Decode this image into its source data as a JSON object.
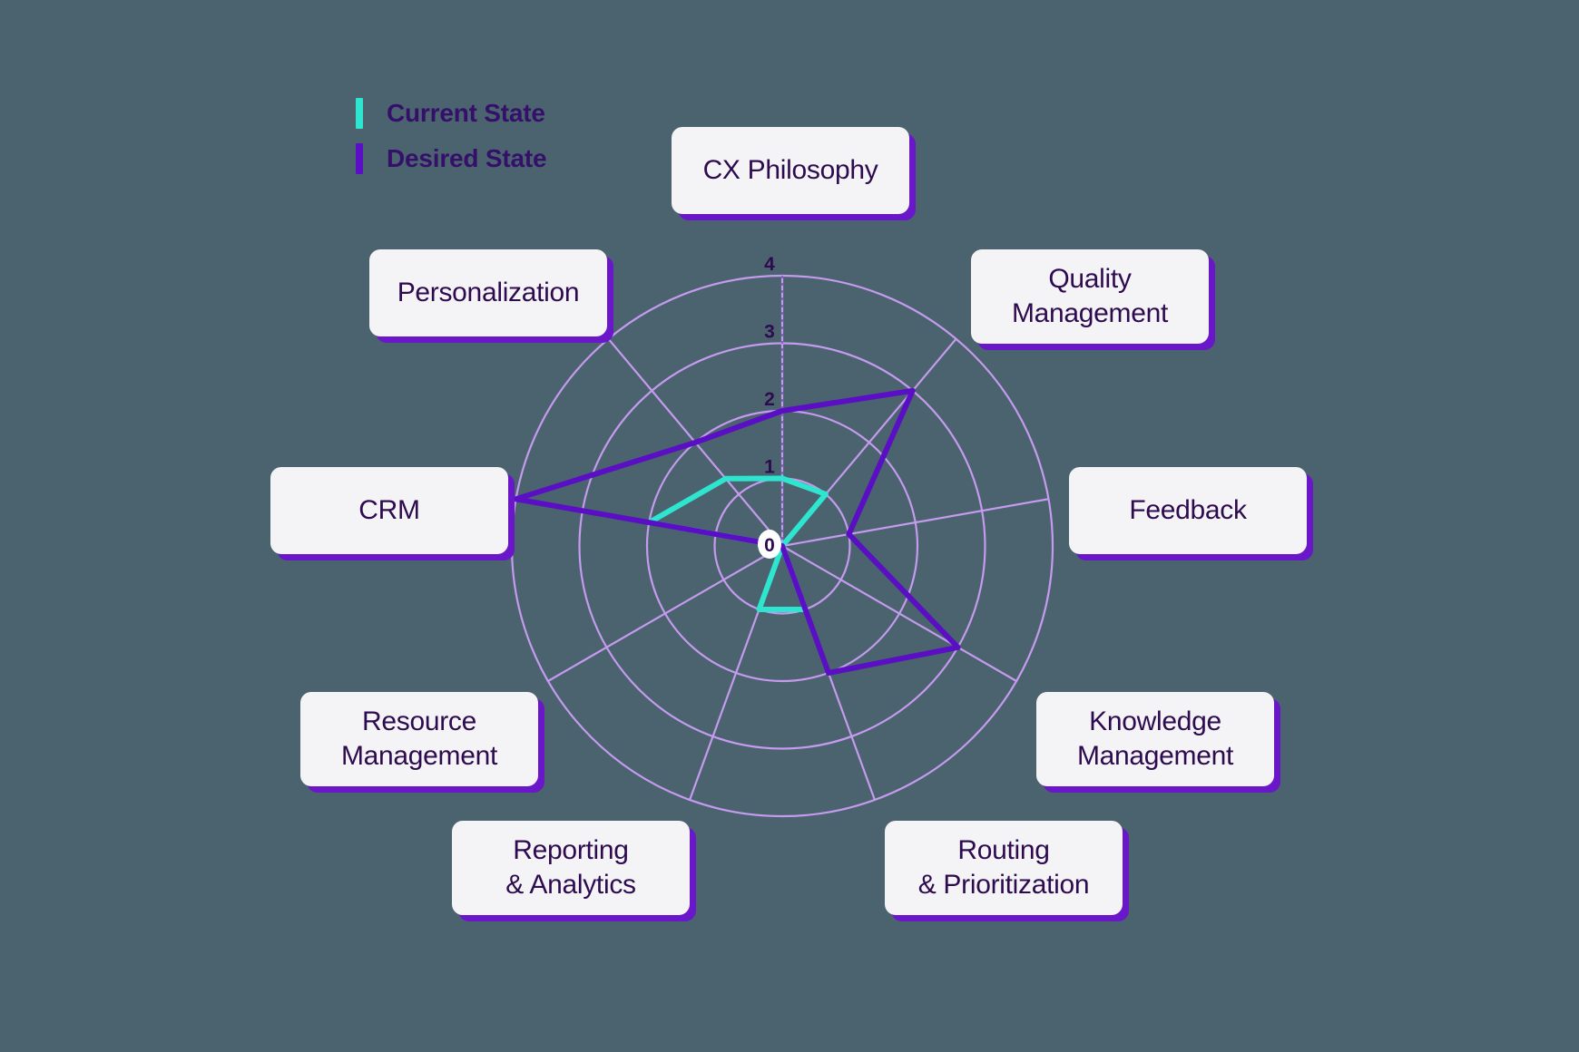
{
  "background_color": "#4b636e",
  "legend": {
    "position": "top-left",
    "items": [
      {
        "label": "Current State",
        "color": "#2ee6d0",
        "swatch": "vertical-bar"
      },
      {
        "label": "Desired State",
        "color": "#5b0fc4",
        "swatch": "vertical-bar"
      }
    ]
  },
  "style": {
    "grid_color": "#c49bee",
    "label_box_bg": "#f4f4f7",
    "label_text_color": "#2e0b4f",
    "label_shadow_color": "#6a16c9",
    "tick_text_color": "#2e0b4f"
  },
  "nodes": [
    {
      "name": "cx-philosophy",
      "label": "CX Philosophy",
      "lines": [
        "CX Philosophy"
      ]
    },
    {
      "name": "quality-management",
      "label": "Quality Management",
      "lines": [
        "Quality",
        "Management"
      ]
    },
    {
      "name": "feedback",
      "label": "Feedback",
      "lines": [
        "Feedback"
      ]
    },
    {
      "name": "knowledge-management",
      "label": "Knowledge Management",
      "lines": [
        "Knowledge",
        "Management"
      ]
    },
    {
      "name": "routing-prioritization",
      "label": "Routing & Prioritization",
      "lines": [
        "Routing",
        "& Prioritization"
      ]
    },
    {
      "name": "reporting-analytics",
      "label": "Reporting & Analytics",
      "lines": [
        "Reporting",
        "& Analytics"
      ]
    },
    {
      "name": "resource-management",
      "label": "Resource Management",
      "lines": [
        "Resource",
        "Management"
      ]
    },
    {
      "name": "crm",
      "label": "CRM",
      "lines": [
        "CRM"
      ]
    },
    {
      "name": "personalization",
      "label": "Personalization",
      "lines": [
        "Personalization"
      ]
    }
  ],
  "chart_data": {
    "type": "radar",
    "title": "",
    "categories": [
      "CX Philosophy",
      "Quality Management",
      "Feedback",
      "Knowledge Management",
      "Routing & Prioritization",
      "Reporting & Analytics",
      "Resource Management",
      "CRM",
      "Personalization"
    ],
    "rlim": [
      0,
      4
    ],
    "rticks": [
      0,
      1,
      2,
      3,
      4
    ],
    "rtick_labels": [
      "0",
      "1",
      "2",
      "3",
      "4"
    ],
    "tick_angle_deg": 90,
    "grid": true,
    "legend_position": "top-left",
    "series": [
      {
        "name": "Current State",
        "color": "#2ee6d0",
        "values": [
          1,
          1,
          0,
          0,
          1,
          1,
          0,
          2,
          1.3
        ]
      },
      {
        "name": "Desired State",
        "color": "#5b0fc4",
        "values": [
          2,
          3,
          1,
          3,
          2,
          0,
          0,
          4,
          2
        ]
      }
    ]
  }
}
